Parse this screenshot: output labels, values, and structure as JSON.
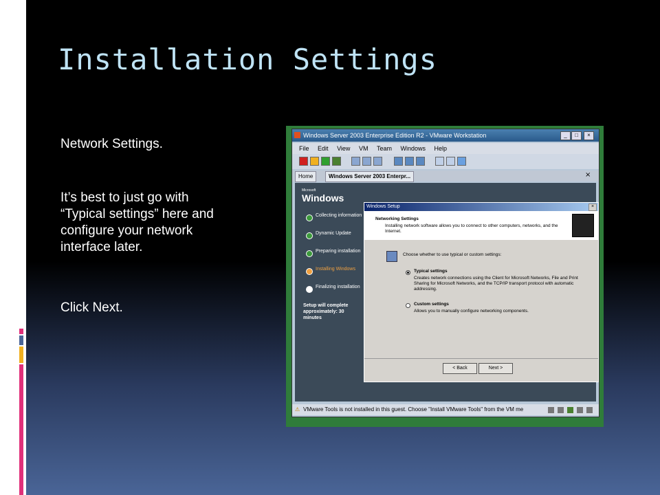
{
  "slide": {
    "title": "Installation Settings",
    "paragraphs": [
      "Network Settings.",
      "It’s best to just go with “Typical settings” here and configure your network interface later.",
      "Click Next."
    ]
  },
  "vmware": {
    "window_title": "Windows Server 2003 Enterprise Edition R2 - VMware Workstation",
    "menu": [
      "File",
      "Edit",
      "View",
      "VM",
      "Team",
      "Windows",
      "Help"
    ],
    "tabs": {
      "home": "Home",
      "vm": "Windows Server 2003 Enterpr..."
    },
    "status_text": "VMware Tools is not installed in this guest. Choose \"Install VMware Tools\" from the VM me"
  },
  "guest": {
    "logo_small": "Microsoft",
    "logo": "Windows",
    "steps": [
      "Collecting information",
      "Dynamic Update",
      "Preparing installation",
      "Installing Windows",
      "Finalizing installation"
    ],
    "remaining": "Setup will complete approximately: 30 minutes"
  },
  "dialog": {
    "title": "Windows Setup",
    "heading": "Networking Settings",
    "subheading": "Installing network software allows you to connect to other computers, networks, and the Internet.",
    "prompt": "Choose whether to use typical or custom settings:",
    "typical_label": "Typical settings",
    "typical_desc": "Creates network connections using the Client for Microsoft Networks, File and Print Sharing for Microsoft Networks, and the TCP/IP transport protocol with automatic addressing.",
    "custom_label": "Custom settings",
    "custom_desc": "Allows you to manually configure networking components.",
    "back_button": "< Back",
    "next_button": "Next >"
  },
  "colors": {
    "title": "#bfe3f5",
    "accent_blue": "#4a6597",
    "accent_pink": "#e0307a",
    "accent_yellow": "#f0b020"
  }
}
